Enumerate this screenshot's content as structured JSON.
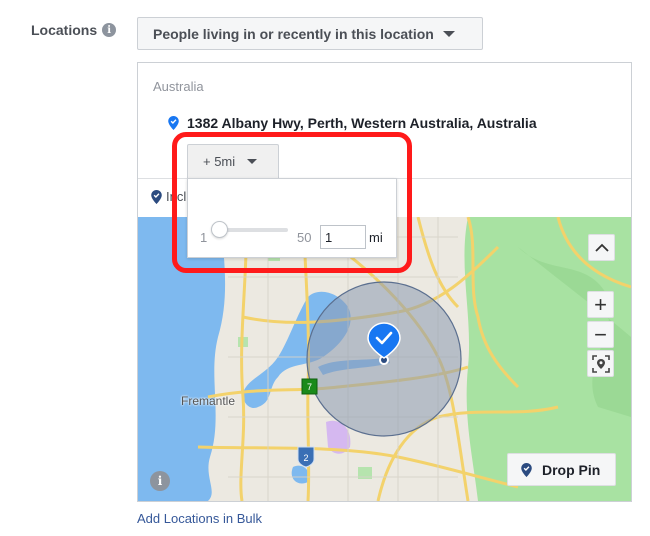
{
  "field": {
    "label": "Locations",
    "info_icon": "info-icon"
  },
  "audience_select": {
    "value": "People living in or recently in this location",
    "icon": "caret-down-icon"
  },
  "location_panel": {
    "country": "Australia",
    "selected_location": "1382 Albany Hwy, Perth, Western Australia, Australia",
    "location_icon": "verified-pin-icon",
    "radius_button": {
      "label": "+ 5mi",
      "icon": "caret-down-icon"
    },
    "include_label": "Include"
  },
  "radius_popup": {
    "slider_min": "1",
    "slider_max": "50",
    "slider_value": 1,
    "input_value": "1",
    "unit": "mi"
  },
  "map": {
    "place_label": "Fremantle",
    "route_shields": [
      "7",
      "2"
    ],
    "controls": {
      "collapse": "chevron-up-icon",
      "zoom_in": "+",
      "zoom_out": "−",
      "locate": "locate-icon"
    },
    "drop_pin_label": "Drop Pin",
    "info_icon": "i"
  },
  "links": {
    "bulk": "Add Locations in Bulk"
  },
  "colors": {
    "highlight": "#ff1a1a",
    "pin_blue": "#1877f2",
    "pin_dark": "#2b4b80",
    "link": "#365899",
    "water": "#7eb9ef",
    "park": "#a8e2a2",
    "radius_fill": "#8c9bb3"
  }
}
